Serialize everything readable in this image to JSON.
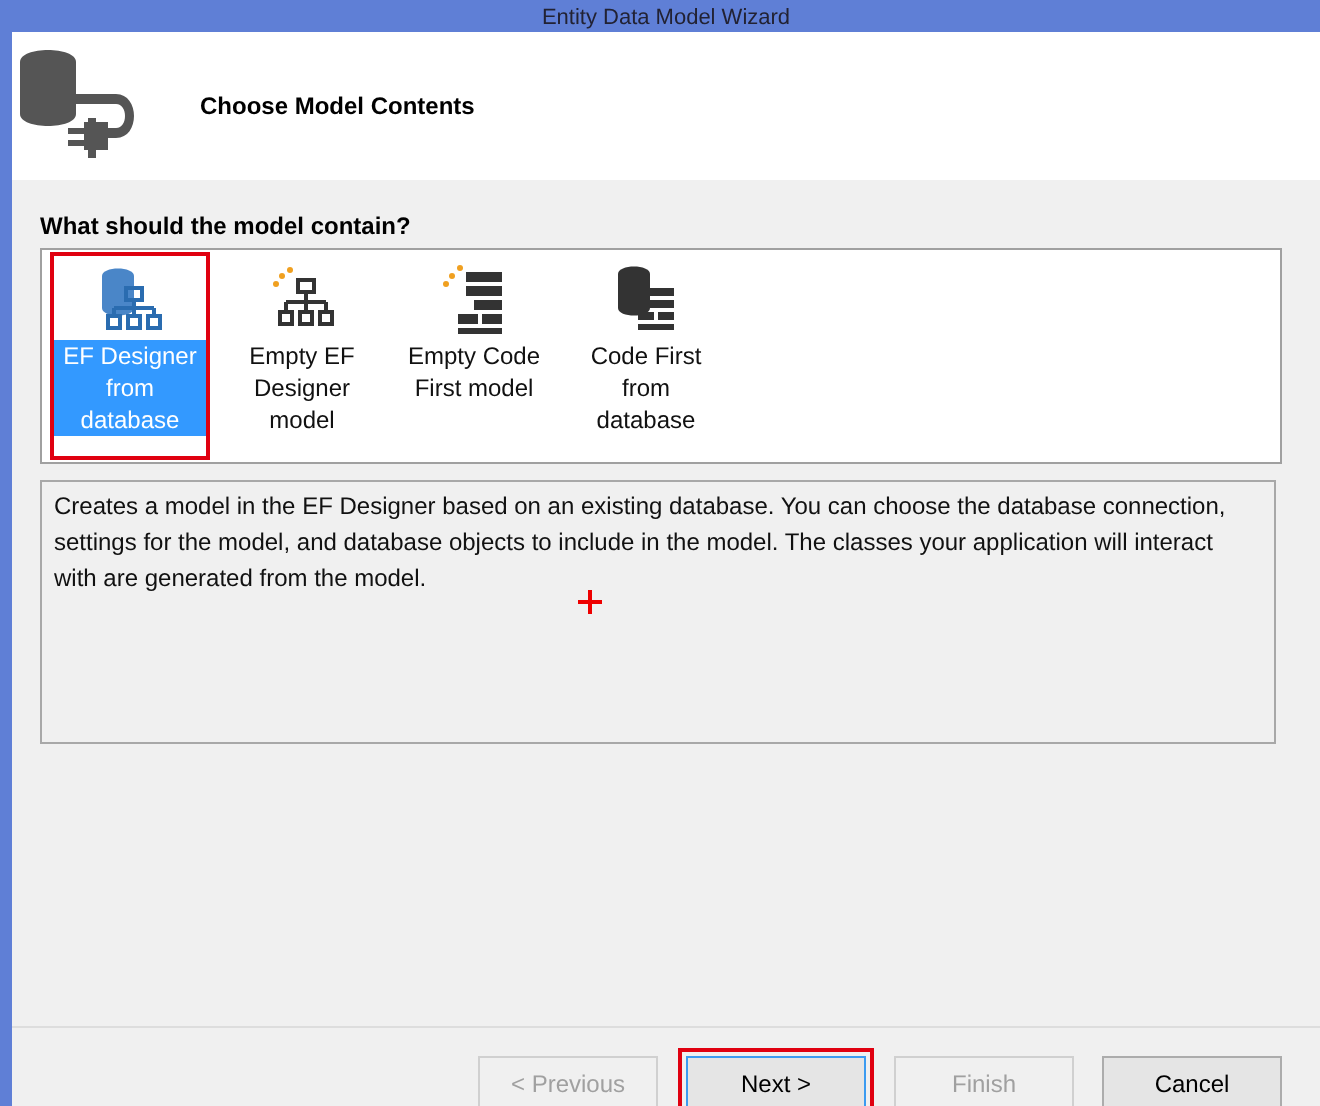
{
  "window": {
    "title": "Entity Data Model Wizard"
  },
  "header": {
    "title": "Choose Model Contents"
  },
  "prompt": "What should the model contain?",
  "model_options": [
    {
      "kind": "designer-db",
      "label": "EF Designer from database",
      "selected": true,
      "annotated": true
    },
    {
      "kind": "designer-empty",
      "label": "Empty EF Designer model",
      "selected": false,
      "annotated": false
    },
    {
      "kind": "code-empty",
      "label": "Empty Code First model",
      "selected": false,
      "annotated": false
    },
    {
      "kind": "code-db",
      "label": "Code First from database",
      "selected": false,
      "annotated": false
    }
  ],
  "description": "Creates a model in the EF Designer based on an existing database. You can choose the database connection, settings for the model, and database objects to include in the model. The classes your application will interact with are generated from the model.",
  "buttons": [
    {
      "label": "< Previous",
      "disabled": true,
      "annotated": false,
      "focused": false
    },
    {
      "label": "Next >",
      "disabled": false,
      "annotated": true,
      "focused": true
    },
    {
      "label": "Finish",
      "disabled": true,
      "annotated": false,
      "focused": false
    },
    {
      "label": "Cancel",
      "disabled": false,
      "annotated": false,
      "focused": false
    }
  ]
}
